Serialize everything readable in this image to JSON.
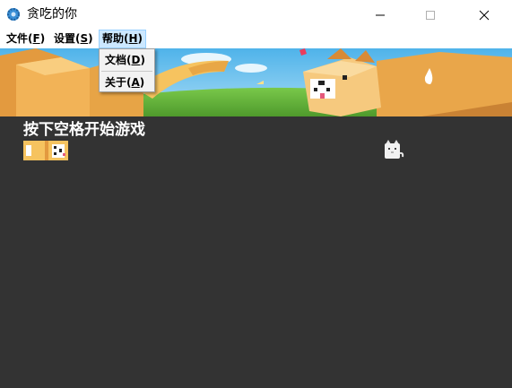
{
  "window": {
    "title": "贪吃的你"
  },
  "menu": {
    "file": {
      "label": "文件(",
      "acc": "F",
      "end": ")"
    },
    "settings": {
      "label": "设置(",
      "acc": "S",
      "end": ")"
    },
    "help": {
      "label": "帮助(",
      "acc": "H",
      "end": ")"
    }
  },
  "help_menu": {
    "items": [
      {
        "label": "文档(",
        "acc": "D",
        "end": ")"
      },
      {
        "label": "关于(",
        "acc": "A",
        "end": ")"
      }
    ]
  },
  "game": {
    "prompt": "按下空格开始游戏"
  },
  "colors": {
    "game_bg": "#333333",
    "accent_menu_hover": "#cce8ff",
    "snake": "#f6c35f"
  }
}
